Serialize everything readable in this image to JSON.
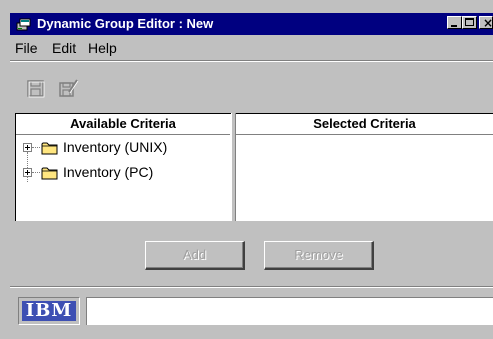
{
  "window": {
    "title": "Dynamic Group Editor : New",
    "icon": "group-editor-icon"
  },
  "menubar": {
    "items": [
      {
        "label": "File"
      },
      {
        "label": "Edit"
      },
      {
        "label": "Help"
      }
    ]
  },
  "toolbar": {
    "buttons": [
      {
        "icon": "save-icon",
        "enabled": false
      },
      {
        "icon": "save-as-icon",
        "enabled": false
      }
    ]
  },
  "available": {
    "header": "Available Criteria",
    "items": [
      {
        "label": "Inventory (UNIX)",
        "icon": "folder-icon",
        "expandable": true
      },
      {
        "label": "Inventory (PC)",
        "icon": "folder-icon",
        "expandable": true
      }
    ]
  },
  "selected": {
    "header": "Selected Criteria",
    "items": []
  },
  "actions": {
    "add_label": "Add",
    "remove_label": "Remove"
  },
  "statusbar": {
    "logo_text": "IBM",
    "status_text": ""
  },
  "colors": {
    "titlebar": "#000080",
    "chrome": "#c0c0c0",
    "logo_bg": "#3d4fb3",
    "folder": "#ffe680"
  }
}
